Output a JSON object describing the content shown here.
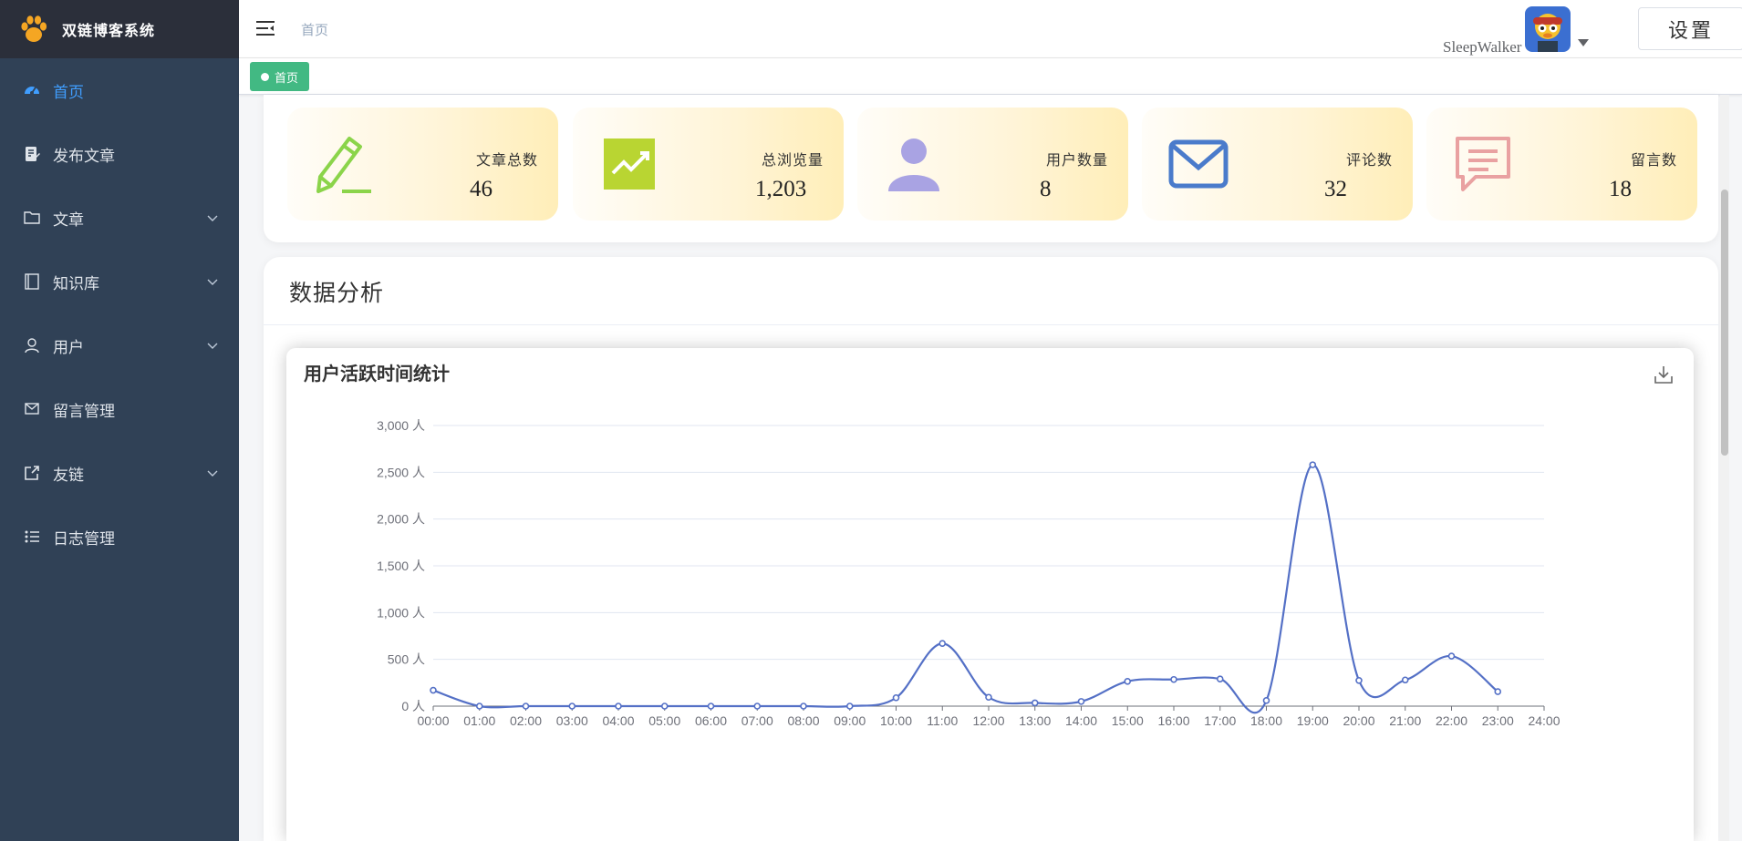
{
  "brand": {
    "title": "双链博客系统"
  },
  "sidebar": {
    "items": [
      {
        "label": "首页",
        "icon": "dashboard-icon",
        "active": true,
        "expandable": false
      },
      {
        "label": "发布文章",
        "icon": "edit-doc-icon",
        "active": false,
        "expandable": false
      },
      {
        "label": "文章",
        "icon": "folder-icon",
        "active": false,
        "expandable": true
      },
      {
        "label": "知识库",
        "icon": "notebook-icon",
        "active": false,
        "expandable": true
      },
      {
        "label": "用户",
        "icon": "user-icon",
        "active": false,
        "expandable": true
      },
      {
        "label": "留言管理",
        "icon": "mail-icon",
        "active": false,
        "expandable": false
      },
      {
        "label": "友链",
        "icon": "external-link-icon",
        "active": false,
        "expandable": true
      },
      {
        "label": "日志管理",
        "icon": "list-icon",
        "active": false,
        "expandable": false
      }
    ]
  },
  "header": {
    "breadcrumb": "首页",
    "username": "SleepWalker",
    "settings_label": "设置"
  },
  "tags": [
    {
      "label": "首页"
    }
  ],
  "stats": [
    {
      "label": "文章总数",
      "value": "46",
      "icon": "pencil-icon",
      "color": "#8bd44a"
    },
    {
      "label": "总浏览量",
      "value": "1,203",
      "icon": "trend-chart-icon",
      "color": "#b9d532"
    },
    {
      "label": "用户数量",
      "value": "8",
      "icon": "person-icon",
      "color": "#a9a3e3"
    },
    {
      "label": "评论数",
      "value": "32",
      "icon": "envelope-icon",
      "color": "#4a7bcb"
    },
    {
      "label": "留言数",
      "value": "18",
      "icon": "message-icon",
      "color": "#e9a1a1"
    }
  ],
  "analysis": {
    "title": "数据分析"
  },
  "chart_data": {
    "type": "line",
    "title": "用户活跃时间统计",
    "x": [
      "00:00",
      "01:00",
      "02:00",
      "03:00",
      "04:00",
      "05:00",
      "06:00",
      "07:00",
      "08:00",
      "09:00",
      "10:00",
      "11:00",
      "12:00",
      "13:00",
      "14:00",
      "15:00",
      "16:00",
      "17:00",
      "18:00",
      "19:00",
      "20:00",
      "21:00",
      "22:00",
      "23:00"
    ],
    "x_ticks": [
      "00:00",
      "01:00",
      "02:00",
      "03:00",
      "04:00",
      "05:00",
      "06:00",
      "07:00",
      "08:00",
      "09:00",
      "10:00",
      "11:00",
      "12:00",
      "13:00",
      "14:00",
      "15:00",
      "16:00",
      "17:00",
      "18:00",
      "19:00",
      "20:00",
      "21:00",
      "22:00",
      "23:00",
      "24:00"
    ],
    "series": [
      {
        "values": [
          170,
          0,
          0,
          0,
          0,
          0,
          0,
          0,
          0,
          0,
          90,
          670,
          95,
          35,
          50,
          265,
          285,
          290,
          60,
          2580,
          275,
          280,
          535,
          155
        ]
      }
    ],
    "ylim": [
      0,
      3000
    ],
    "y_ticks": [
      0,
      500,
      1000,
      1500,
      2000,
      2500,
      3000
    ],
    "y_unit": "人",
    "grid": true,
    "line_color": "#5470c6",
    "smooth": true
  }
}
